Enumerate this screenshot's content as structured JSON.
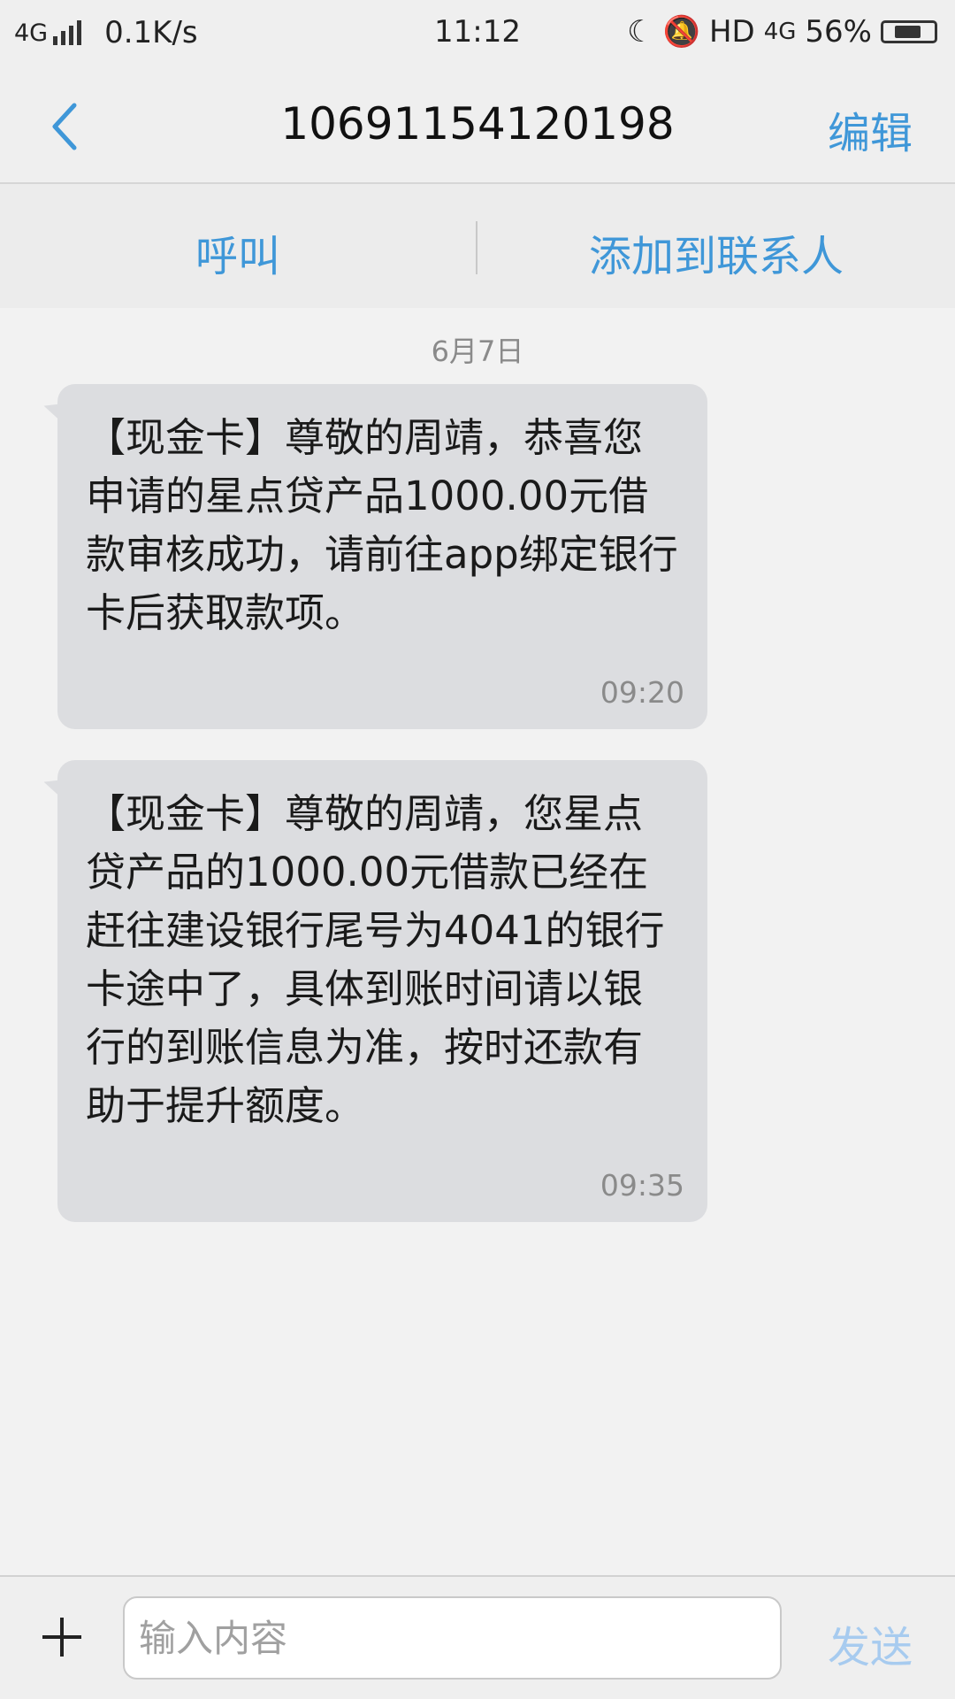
{
  "status_bar": {
    "network": "4G",
    "speed": "0.1K/s",
    "time": "11:12",
    "hd": "HD",
    "network2": "4G",
    "battery": "56%",
    "battery_level": 0.56
  },
  "header": {
    "title": "10691154120198",
    "edit_label": "编辑",
    "back_icon": "chevron-left-icon"
  },
  "actions": {
    "call_label": "呼叫",
    "add_contact_label": "添加到联系人"
  },
  "conversation": {
    "date": "6月7日",
    "messages": [
      {
        "text": "【现金卡】尊敬的周靖，恭喜您申请的星点贷产品1000.00元借款审核成功，请前往app绑定银行卡后获取款项。",
        "time": "09:20"
      },
      {
        "text": "【现金卡】尊敬的周靖，您星点贷产品的1000.00元借款已经在赶往建设银行尾号为4041的银行卡途中了，具体到账时间请以银行的到账信息为准，按时还款有助于提升额度。",
        "time": "09:35"
      }
    ]
  },
  "composer": {
    "placeholder": "输入内容",
    "send_label": "发送"
  },
  "colors": {
    "accent": "#3f97d8",
    "bubble": "#dcdde0",
    "send_disabled": "#a7cbef"
  }
}
